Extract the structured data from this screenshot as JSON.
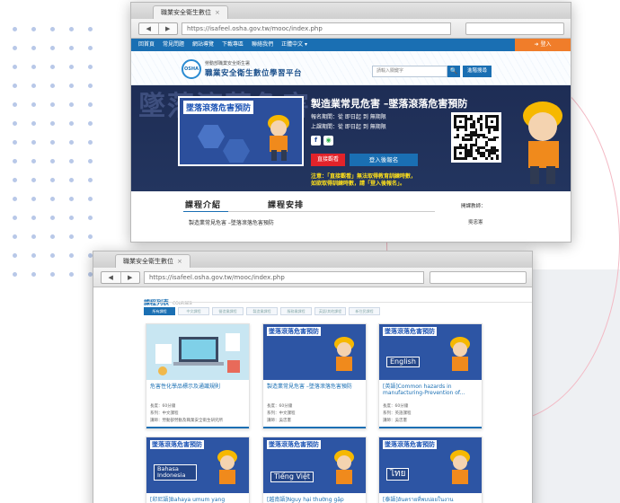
{
  "top_window": {
    "tab_title": "職業安全衛生數位",
    "url": "https://isafeel.osha.gov.tw/mooc/index.php",
    "nav_items": [
      "回首頁",
      "常見問題",
      "網站導覽",
      "下載專區",
      "聯絡我們",
      "正體中文 ▾"
    ],
    "login_label": "登入",
    "logo_badge": "OSHA",
    "logo_subtitle": "勞動部職業安全衛生署",
    "logo_title": "職業安全衛生數位學習平台",
    "search_placeholder": "請輸入關鍵字",
    "search_icon": "🔍",
    "adv_search_label": "進階搜尋",
    "banner_ghost_text": "墜落滾落危害",
    "video_title": "墜落滾落危害預防",
    "course_title": "製造業常見危害 –墜落滾落危害預防",
    "signup_period": "報名期間：從 即日起 到 無期限",
    "class_period": "上課期間：從 即日起 到 無期限",
    "facebook_icon": "f",
    "line_icon": "◉",
    "btn_direct": "直接觀看",
    "btn_login_signup": "登入後報名",
    "notice_line1": "注意：「直接觀看」無法取得教育訓練時數，",
    "notice_line2": "如欲取得訓練時數，請「登入後報名」。",
    "tab_intro": "課程介紹",
    "tab_schedule": "課程安排",
    "course_desc": "製造業常見危害 –墜落滾落危害預防",
    "teacher_label": "開課教師：",
    "teacher_name": "吳忠憲"
  },
  "bottom_window": {
    "tab_title": "職業安全衛生數位",
    "url": "https://isafeel.osha.gov.tw/mooc/index.php",
    "list_title": "課程列表",
    "list_subtitle": "COURSES",
    "filters": [
      "所有課程",
      "中文課程",
      "營造業課程",
      "製造業課程",
      "服務業課程",
      "英語/其他課程",
      "新住民課程"
    ],
    "cards": [
      {
        "title": "危害性化學品標示及通識規則",
        "hours": "長度：60分鐘",
        "series": "系列：中文課程",
        "teacher": "講師：勞動部勞動及職業安全衛生研究所"
      },
      {
        "thumb_title": "墜落滾落危害預防",
        "title": "製造業常見危害 –墜落滾落危害預防",
        "hours": "長度：60分鐘",
        "series": "系列：中文課程",
        "teacher": "講師：吳忠憲"
      },
      {
        "thumb_title": "墜落滾落危害預防",
        "lang": "English",
        "title": "[英語]Common hazards in manufacturing-Prevention of...",
        "hours": "長度：60分鐘",
        "series": "系列：英語課程",
        "teacher": "講師：吳忠憲"
      },
      {
        "thumb_title": "墜落滾落危害預防",
        "lang": "Bahasa Indonesia",
        "title": "[印尼語]Bahaya umum yang"
      },
      {
        "thumb_title": "墜落滾落危害預防",
        "lang": "Tiếng Việt",
        "title": "[越南語]Nguy hại thường gặp"
      },
      {
        "thumb_title": "墜落滾落危害預防",
        "lang": "ไทย",
        "title": "[泰語]อันตรายที่พบบ่อยในงาน"
      }
    ]
  },
  "colors": {
    "primary_blue": "#1a6fb3",
    "login_orange": "#f07d2a",
    "banner_navy": "#1e2d55",
    "direct_red": "#e2232a",
    "notice_yellow": "#ffe11a"
  }
}
